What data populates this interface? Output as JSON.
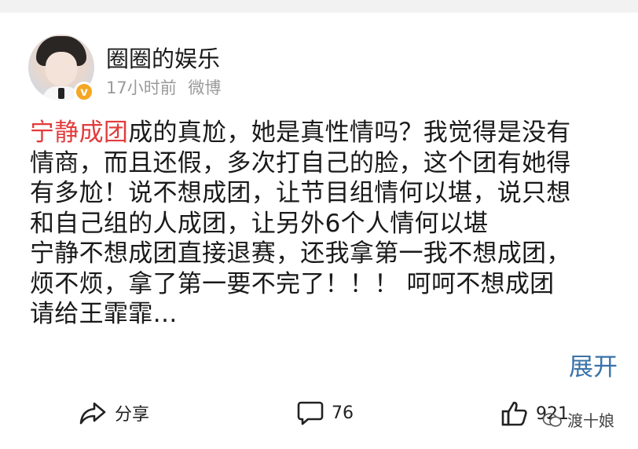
{
  "post": {
    "author": "圈圈的娱乐",
    "time": "17小时前",
    "source": "微博",
    "verified_badge": "v",
    "content": {
      "topic": "宁静成团",
      "lines": [
        "成的真尬，她是真性情吗？我觉得是没有",
        "情商，而且还假，多次打自己的脸，这个团有她得",
        "有多尬！说不想成团，让节目组情何以堪，说只想",
        "和自己组的人成团，让另外6个人情何以堪",
        "宁静不想成团直接退赛，还我拿第一我不想成团，",
        "烦不烦，拿了第一要不完了！！！ 呵呵不想成团",
        "请给王霏霏…"
      ]
    },
    "expand_label": "展开",
    "actions": {
      "share_label": "分享",
      "comment_count": "76",
      "like_count": "921"
    }
  },
  "watermark": {
    "text": "渡十娘",
    "icon": "wechat-icon"
  },
  "colors": {
    "topic": "#e23c3c",
    "expand": "#3a72a8",
    "badge": "#f5a623",
    "meta": "#9a9a9a"
  }
}
